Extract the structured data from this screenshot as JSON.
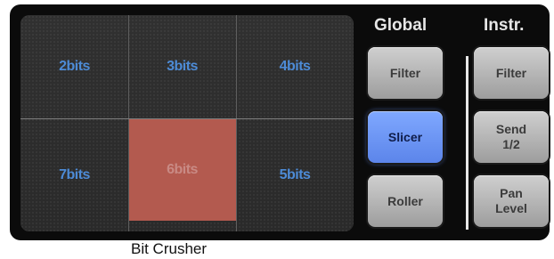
{
  "pad": {
    "cells": [
      {
        "label": "2bits",
        "active": false
      },
      {
        "label": "3bits",
        "active": false
      },
      {
        "label": "4bits",
        "active": false
      },
      {
        "label": "7bits",
        "active": false
      },
      {
        "label": "6bits",
        "active": true
      },
      {
        "label": "5bits",
        "active": false
      }
    ]
  },
  "global": {
    "header": "Global",
    "buttons": [
      {
        "label": "Filter",
        "active": false
      },
      {
        "label": "Slicer",
        "active": true
      },
      {
        "label": "Roller",
        "active": false
      }
    ]
  },
  "instr": {
    "header": "Instr.",
    "buttons": [
      {
        "label": "Filter"
      },
      {
        "label": "Send 1/2"
      },
      {
        "label": "Pan Level"
      }
    ]
  },
  "caption": "Bit Crusher",
  "colors": {
    "active_cell": "#b35a4f",
    "active_button": "#6b94f5",
    "cell_text": "#4d8bd6"
  }
}
